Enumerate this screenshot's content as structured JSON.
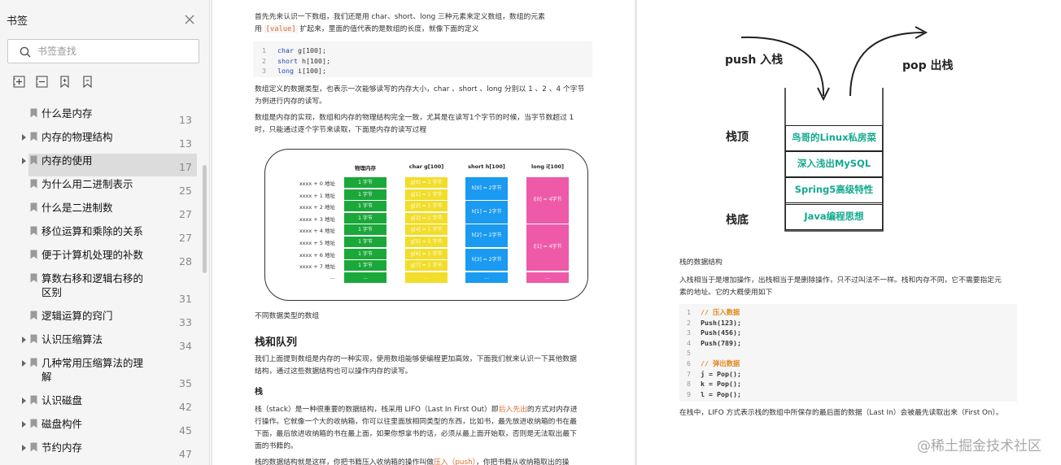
{
  "sidebar": {
    "title": "书签",
    "search_placeholder": "书签查找",
    "items": [
      {
        "label": "什么是内存",
        "page": "13",
        "expandable": false,
        "selected": false
      },
      {
        "label": "内存的物理结构",
        "page": "13",
        "expandable": true,
        "selected": false
      },
      {
        "label": "内存的使用",
        "page": "17",
        "expandable": true,
        "selected": true
      },
      {
        "label": "为什么用二进制表示",
        "page": "25",
        "expandable": false,
        "selected": false
      },
      {
        "label": "什么是二进制数",
        "page": "27",
        "expandable": false,
        "selected": false
      },
      {
        "label": "移位运算和乘除的关系",
        "page": "27",
        "expandable": false,
        "selected": false
      },
      {
        "label": "便于计算机处理的补数",
        "page": "28",
        "expandable": false,
        "selected": false
      },
      {
        "label": "算数右移和逻辑右移的区别",
        "page": "31",
        "expandable": false,
        "selected": false
      },
      {
        "label": "逻辑运算的窍门",
        "page": "33",
        "expandable": false,
        "selected": false
      },
      {
        "label": "认识压缩算法",
        "page": "34",
        "expandable": true,
        "selected": false
      },
      {
        "label": "几种常用压缩算法的理解",
        "page": "35",
        "expandable": true,
        "selected": false
      },
      {
        "label": "认识磁盘",
        "page": "42",
        "expandable": true,
        "selected": false
      },
      {
        "label": "磁盘构件",
        "page": "45",
        "expandable": true,
        "selected": false
      },
      {
        "label": "节约内存",
        "page": "47",
        "expandable": true,
        "selected": false
      }
    ]
  },
  "left_page": {
    "intro_1": "首先先来认识一下数组，我们还是用 char、short、long 三种元素来定义数组，数组的元素",
    "intro_2a": "用",
    "intro_2_code": "[value]",
    "intro_2b": "扩起来，里面的值代表的是数组的长度，就像下面的定义",
    "code_lines": [
      "char g[100];",
      "short h[100];",
      "long i[100];"
    ],
    "code_keywords": [
      "char",
      "short",
      "long"
    ],
    "code_rest": [
      " g[100];",
      " h[100];",
      " i[100];"
    ],
    "para_1a": "数组定义的数据类型，也表示一次能够读写的内存大小，char 、short 、long 分别以 1 、2 、4 个字节",
    "para_1b": "为例进行内存的读写。",
    "para_2a": "数组是内存的实现，数组和内存的物理结构完全一致，尤其是在读写1个字节的时候，当字节数超过 1",
    "para_2b": "时，只能通过逐个字节来读取，下面是内存的读写过程",
    "diagram": {
      "headers": [
        "物理内存",
        "char g[100]",
        "short h[100]",
        "long i[100]"
      ],
      "addresses": [
        "xxxx + 0 地址",
        "xxxx + 1 地址",
        "xxxx + 2 地址",
        "xxxx + 3 地址",
        "xxxx + 4 地址",
        "xxxx + 5 地址",
        "xxxx + 6 地址",
        "xxxx + 7 地址",
        "..."
      ],
      "byte_cell": "1 字节",
      "char_cells": [
        "g[0] = 1 字节",
        "g[1] = 1 字节",
        "g[2] = 1 字节",
        "g[3] = 1 字节",
        "g[4] = 1 字节",
        "g[5] = 1 字节",
        "g[6] = 1 字节",
        "g[7] = 1 字节"
      ],
      "short_cells": [
        "h[0] = 2字节",
        "h[1] = 2字节",
        "h[2] = 2字节",
        "h[3] = 2字节"
      ],
      "long_cells": [
        "i[0] = 4字节",
        "i[1] = 4字节"
      ],
      "ellipsis": "...",
      "colors": {
        "green": "#1aa83a",
        "yellow": "#f2dd2a",
        "blue": "#1a9af0",
        "pink": "#ee5aa8"
      }
    },
    "caption": "不同数据类型的数组",
    "heading_stack_queue": "栈和队列",
    "para_3a": "我们上面提到数组是内存的一种实现，使用数组能够使编程更加高效，下面我们就来认识一下其他数据",
    "para_3b": "结构，通过这些数据结构也可以操作内存的读写。",
    "heading_stack": "栈",
    "para_4a_pre": "栈（stack）是一种很重要的数据结构，栈采用 LIFO（Last In First Out）即",
    "para_4a_hl": "后入先出",
    "para_4a_post": "的方式对内存进",
    "para_4b": "行操作。它就像一个大的收纳箱，你可以往里面放相同类型的东西，比如书，最先放进收纳箱的书在最",
    "para_4c": "下面，最后放进收纳箱的书在最上面，如果你想拿书的话，必须从最上面开始取，否则是无法取出最下",
    "para_4d": "面的书籍的。",
    "para_5_pre": "栈的数据结构就是这样，你把书籍压入收纳箱的操作叫做",
    "para_5_hl": "压入（push）",
    "para_5_post": "，你把书籍从收纳箱取出的操"
  },
  "right_page": {
    "push_label": "push 入栈",
    "pop_label": "pop 出栈",
    "top_label": "栈顶",
    "bottom_label": "栈底",
    "stack_items": [
      "鸟哥的Linux私房菜",
      "深入浅出MySQL",
      "Spring5高级特性",
      "Java编程思想"
    ],
    "section_title": "栈的数据结构",
    "para_1a": "入栈相当于是增加操作，出栈相当于是删除操作，只不过叫法不一样。栈和内存不同，它不需要指定元",
    "para_1b": "素的地址。它的大概使用如下",
    "code_lines": [
      "// 压入数据",
      "Push(123);",
      "Push(456);",
      "Push(789);",
      "",
      "// 弹出数据",
      "j = Pop();",
      "k = Pop();",
      "l = Pop();"
    ],
    "para_2": "在栈中，LIFO 方式表示栈的数组中所保存的最后面的数据（Last In）会被最先读取出来（First On）。"
  },
  "watermark": "@稀土掘金技术社区"
}
